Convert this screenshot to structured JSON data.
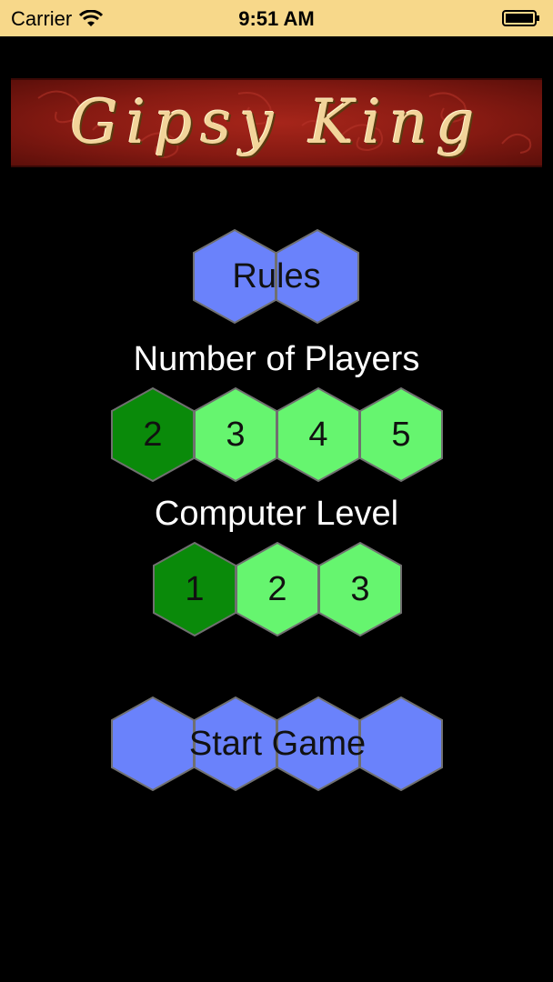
{
  "status_bar": {
    "carrier": "Carrier",
    "time": "9:51 AM"
  },
  "banner": {
    "title": "Gipsy King"
  },
  "rules": {
    "label": "Rules"
  },
  "players": {
    "heading": "Number of Players",
    "options": [
      "2",
      "3",
      "4",
      "5"
    ],
    "selected": "2"
  },
  "level": {
    "heading": "Computer Level",
    "options": [
      "1",
      "2",
      "3"
    ],
    "selected": "1"
  },
  "start": {
    "label": "Start Game"
  },
  "colors": {
    "blue_hex": "#6a82fb",
    "green_hex": "#66f56f",
    "selected_hex": "#0a8a0a",
    "hex_border": "#707070",
    "status_bar": "#f7d88a",
    "banner_red": "#8b1d14",
    "banner_text": "#f2d49a"
  }
}
